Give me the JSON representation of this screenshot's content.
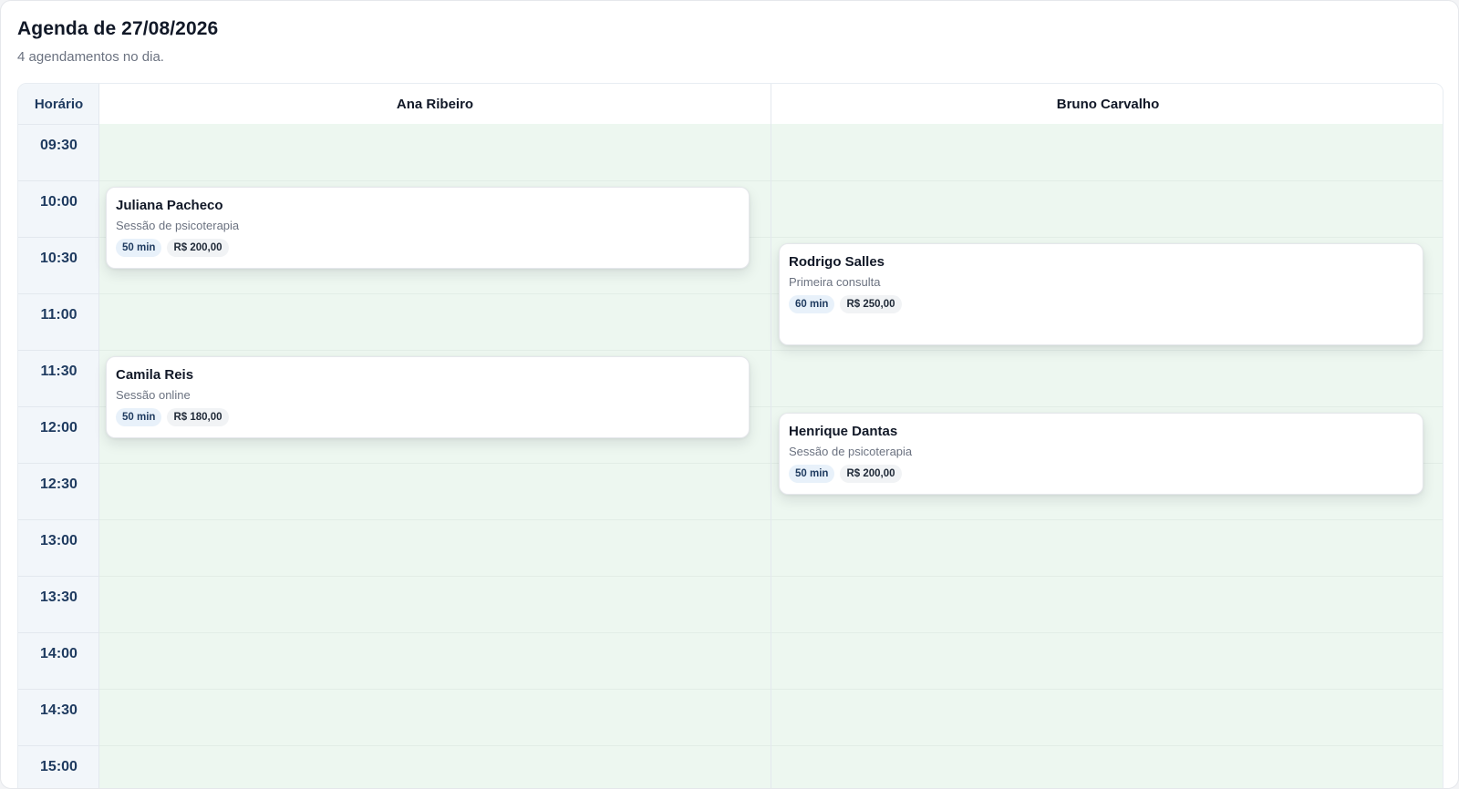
{
  "header": {
    "title": "Agenda de 27/08/2026",
    "subtitle": "4 agendamentos no dia."
  },
  "grid": {
    "time_header": "Horário",
    "slots": [
      "09:30",
      "10:00",
      "10:30",
      "11:00",
      "11:30",
      "12:00",
      "12:30",
      "13:00",
      "13:30",
      "14:00",
      "14:30",
      "15:00"
    ],
    "professionals": [
      {
        "name": "Ana Ribeiro",
        "appointments": [
          {
            "patient": "Juliana Pacheco",
            "type": "Sessão de psicoterapia",
            "duration": "50 min",
            "price": "R$ 200,00",
            "start": "10:00"
          },
          {
            "patient": "Camila Reis",
            "type": "Sessão online",
            "duration": "50 min",
            "price": "R$ 180,00",
            "start": "11:30"
          }
        ]
      },
      {
        "name": "Bruno Carvalho",
        "appointments": [
          {
            "patient": "Rodrigo Salles",
            "type": "Primeira consulta",
            "duration": "60 min",
            "price": "R$ 250,00",
            "start": "10:30"
          },
          {
            "patient": "Henrique Dantas",
            "type": "Sessão de psicoterapia",
            "duration": "50 min",
            "price": "R$ 200,00",
            "start": "12:00"
          }
        ]
      }
    ]
  },
  "colors": {
    "slot_background": "#edf7f0",
    "time_column": "#f2f6fa",
    "time_text": "#1e3a5f"
  }
}
